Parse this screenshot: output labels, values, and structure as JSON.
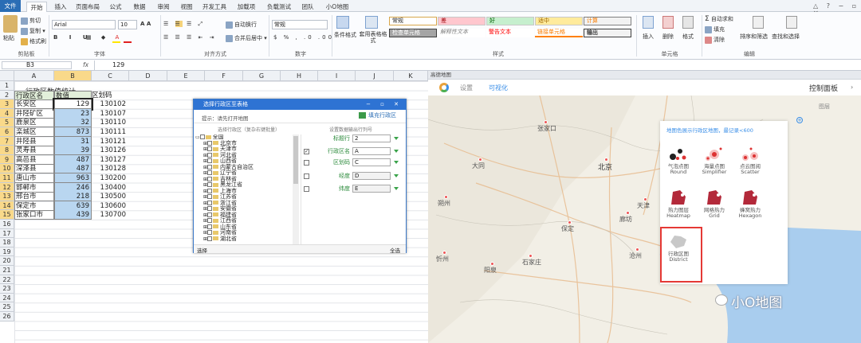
{
  "ribbon": {
    "tabs": [
      "文件",
      "开始",
      "插入",
      "页面布局",
      "公式",
      "数据",
      "审阅",
      "视图",
      "开发工具",
      "加载项",
      "负载测试",
      "团队",
      "小O地图"
    ],
    "clipboard": {
      "paste": "粘贴",
      "cut": "剪切",
      "copy": "复制 ▾",
      "painter": "格式刷",
      "group": "剪贴板"
    },
    "font": {
      "name": "Arial",
      "size": "10",
      "group": "字体"
    },
    "align": {
      "wrap": "自动换行",
      "merge": "合并后居中 ▾",
      "group": "对齐方式"
    },
    "number": {
      "format": "常规",
      "group": "数字"
    },
    "styles": {
      "cond": "条件格式",
      "table": "套用表格格式",
      "items": [
        "常规",
        "差",
        "好",
        "适中",
        "计算",
        "检查单元格",
        "解释性文本",
        "警告文本",
        "链接单元格",
        "输出"
      ],
      "group": "样式"
    },
    "cells": {
      "insert": "插入",
      "delete": "删除",
      "format": "格式",
      "group": "单元格"
    },
    "edit": {
      "autosum": "自动求和",
      "fill": "填充",
      "clear": "清除",
      "sort": "排序和筛选",
      "find": "查找和选择",
      "group": "编辑"
    }
  },
  "formula": {
    "namebox": "B3",
    "fx": "fx",
    "value": "129"
  },
  "sheet": {
    "columns": [
      "A",
      "B",
      "C",
      "D",
      "E",
      "F",
      "G",
      "H",
      "I",
      "J",
      "K"
    ],
    "rows": [
      "1",
      "2",
      "3",
      "4",
      "5",
      "6",
      "7",
      "8",
      "9",
      "10",
      "11",
      "12",
      "13",
      "14",
      "15",
      "16",
      "17",
      "18",
      "19",
      "20",
      "21",
      "22",
      "23",
      "24",
      "25",
      "26"
    ],
    "title": "行政区数值统计",
    "headers": [
      "行政区名",
      "数值",
      "区划码"
    ],
    "data": [
      [
        "长安区",
        "129",
        "130102"
      ],
      [
        "井陉矿区",
        "23",
        "130107"
      ],
      [
        "鹿泉区",
        "32",
        "130110"
      ],
      [
        "栾城区",
        "873",
        "130111"
      ],
      [
        "井陉县",
        "31",
        "130121"
      ],
      [
        "灵寿县",
        "39",
        "130126"
      ],
      [
        "高邑县",
        "487",
        "130127"
      ],
      [
        "深泽县",
        "487",
        "130128"
      ],
      [
        "唐山市",
        "963",
        "130200"
      ],
      [
        "邯郸市",
        "246",
        "130400"
      ],
      [
        "邢台市",
        "218",
        "130500"
      ],
      [
        "保定市",
        "639",
        "130600"
      ],
      [
        "张家口市",
        "439",
        "130700"
      ]
    ]
  },
  "dialog": {
    "title": "选择行政区至表格",
    "hint": "提示：请先打开地图",
    "fill_btn": "填充行政区",
    "tree_header": "选择行政区（复杂右键批量）",
    "fields_header": "设置数据输出行列号",
    "tree": [
      "全国",
      "北京市",
      "天津市",
      "河北省",
      "山西省",
      "内蒙古自治区",
      "辽宁省",
      "吉林省",
      "黑龙江省",
      "上海市",
      "江苏省",
      "浙江省",
      "安徽省",
      "福建省",
      "江西省",
      "山东省",
      "河南省",
      "湖北省"
    ],
    "fields": [
      {
        "label": "标题行",
        "value": "2"
      },
      {
        "label": "行政区名",
        "value": "A"
      },
      {
        "label": "区划码",
        "value": "C"
      },
      {
        "label": "经度",
        "value": "D"
      },
      {
        "label": "纬度",
        "value": "E"
      }
    ],
    "footer_left": "选择",
    "footer_right": "全选"
  },
  "map": {
    "window_title": "高德地图",
    "toolbar": [
      "设置",
      "可视化"
    ],
    "control_panel": "控制面板",
    "layers": "图层",
    "panel_hint": "地图色展示行政区地图，最记录<600",
    "icons": [
      {
        "cn": "气泡点图",
        "en": "Round"
      },
      {
        "cn": "海量点图",
        "en": "Simplifier"
      },
      {
        "cn": "点云图阅",
        "en": "Scatter"
      },
      {
        "cn": "热力图层",
        "en": "Heatmap"
      },
      {
        "cn": "网格热力",
        "en": "Grid"
      },
      {
        "cn": "蜂窝热力",
        "en": "Hexagon"
      },
      {
        "cn": "行政区图",
        "en": "District"
      }
    ],
    "cities": [
      "张家口",
      "大同",
      "北京",
      "天津",
      "保定",
      "石家庄",
      "沧州",
      "朔州",
      "忻州",
      "阳泉",
      "唐山",
      "廊坊"
    ],
    "watermark": "小O地图",
    "accent": "#3b8fe8",
    "highlight": "#e53935"
  }
}
